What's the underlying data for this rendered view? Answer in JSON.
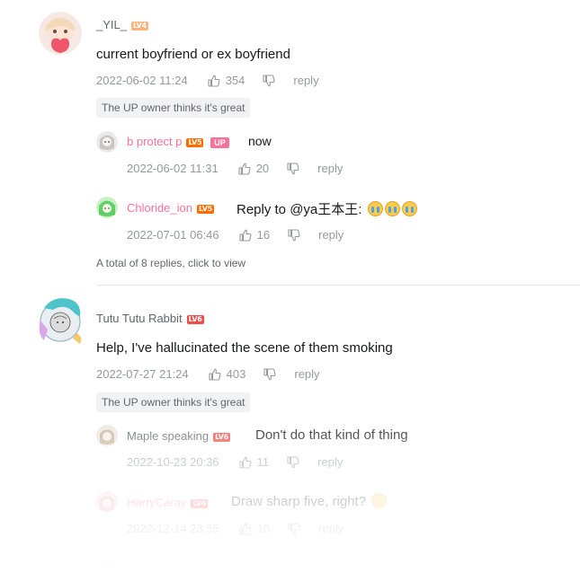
{
  "comments": [
    {
      "username": "_YIL_",
      "level": "LV4",
      "text": "current boyfriend or ex boyfriend",
      "date": "2022-06-02 11:24",
      "likes": "354",
      "reply_label": "reply",
      "up_liked": "The UP owner thinks it's great",
      "replies": [
        {
          "username": "b protect p",
          "level": "LV5",
          "is_up": "UP",
          "text": "now",
          "date": "2022-06-02 11:31",
          "likes": "20",
          "reply_label": "reply"
        },
        {
          "username": "Chloride_ion",
          "level": "LV5",
          "text": "Reply to @ya王本王:",
          "date": "2022-07-01 06:46",
          "likes": "16",
          "reply_label": "reply"
        }
      ],
      "view_more": "A total of 8 replies, click to view"
    },
    {
      "username": "Tutu Tutu Rabbit",
      "level": "LV6",
      "text": "Help, I've hallucinated the scene of them smoking",
      "date": "2022-07-27 21:24",
      "likes": "403",
      "reply_label": "reply",
      "up_liked": "The UP owner thinks it's great",
      "replies": [
        {
          "username": "Maple speaking",
          "level": "LV6",
          "text": "Don't do that kind of thing",
          "date": "2022-10-23 20:36",
          "likes": "11",
          "reply_label": "reply"
        },
        {
          "username": "HarryCaray",
          "level": "LV6",
          "text": "Draw sharp five, right?",
          "date": "2022-12-14 23:55",
          "likes": "10",
          "reply_label": "reply"
        }
      ]
    }
  ],
  "colors": {
    "pink": "#fb7299",
    "text": "#18191c",
    "meta": "#9499a0",
    "lv4": "#ffb37c",
    "lv5": "#ff6c00",
    "lv6": "#f04c49"
  }
}
